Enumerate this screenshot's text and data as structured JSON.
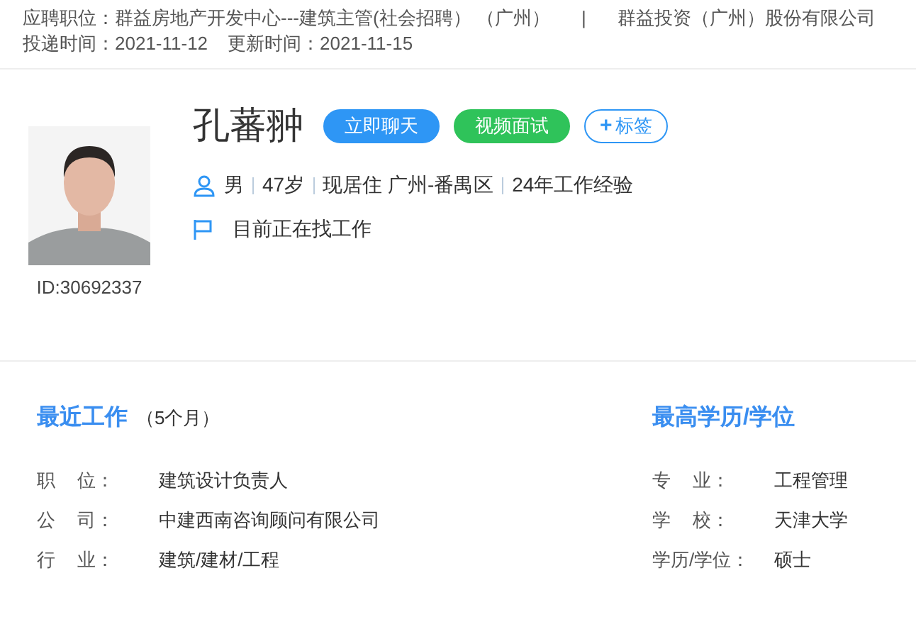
{
  "header": {
    "position_label": "应聘职位：",
    "position": "群益房地产开发中心---建筑主管(社会招聘） （广州）",
    "separator": "|",
    "company": "群益投资（广州）股份有限公司",
    "delivered_label": "投递时间：",
    "delivered": "2021-11-12",
    "updated_label": "更新时间：",
    "updated": "2021-11-15"
  },
  "profile": {
    "id": "ID:30692337",
    "name": "孔蕃翀",
    "buttons": [
      {
        "kind": "chat",
        "label": "立即聊天"
      },
      {
        "kind": "video",
        "label": "视频面试"
      },
      {
        "kind": "tag",
        "icon": "+",
        "label": "标签"
      }
    ],
    "facts": [
      "男",
      "47岁",
      "现居住 广州-番禺区",
      "24年工作经验"
    ],
    "status": "目前正在找工作"
  },
  "recent_work": {
    "title": "最近工作",
    "duration": "（5个月）",
    "rows": [
      {
        "label": "职 位：",
        "value": "建筑设计负责人"
      },
      {
        "label": "公 司：",
        "value": "中建西南咨询顾问有限公司"
      },
      {
        "label": "行 业：",
        "value": "建筑/建材/工程"
      }
    ]
  },
  "education": {
    "title": "最高学历/学位",
    "rows": [
      {
        "label": "专 业：",
        "value": "工程管理"
      },
      {
        "label": "学 校：",
        "value": "天津大学"
      },
      {
        "label": "学历/学位：",
        "value": "硕士"
      }
    ]
  }
}
